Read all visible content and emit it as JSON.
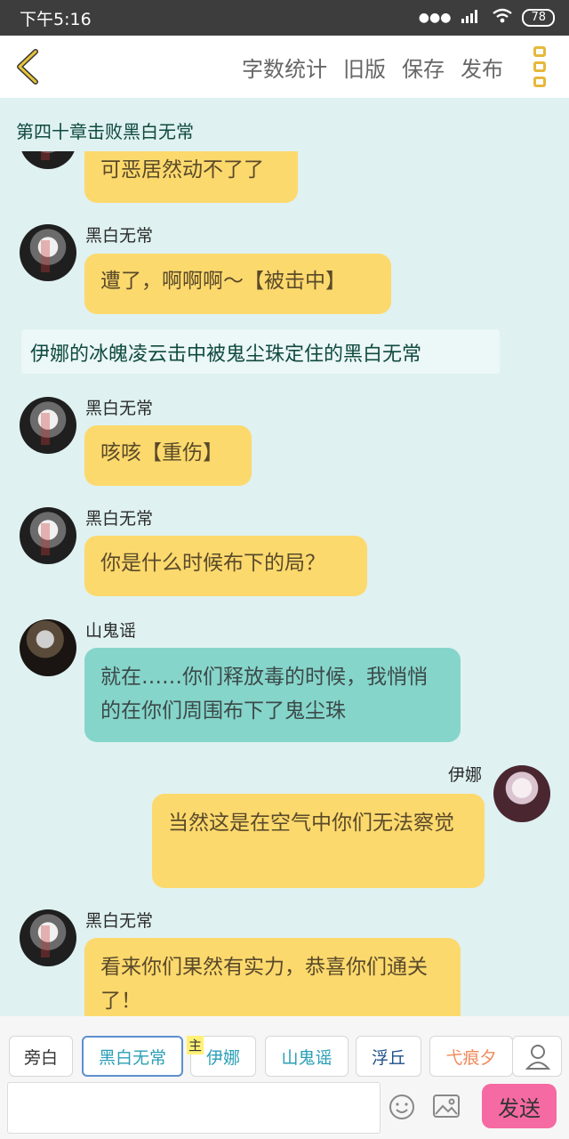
{
  "status_bar": {
    "time": "下午5:16",
    "signal_label": "HD",
    "battery": "78"
  },
  "toolbar": {
    "actions": [
      "字数统计",
      "旧版",
      "保存",
      "发布"
    ]
  },
  "chapter_title": "第四十章击败黑白无常",
  "messages": [
    {
      "speaker": "",
      "text": "可恶居然动不了了",
      "type": "left"
    },
    {
      "speaker": "黑白无常",
      "text": "遭了，啊啊啊～【被击中】",
      "type": "left"
    },
    {
      "speaker": "",
      "text": "伊娜的冰魄凌云击中被鬼尘珠定住的黑白无常",
      "type": "narration"
    },
    {
      "speaker": "黑白无常",
      "text": "咳咳【重伤】",
      "type": "left"
    },
    {
      "speaker": "黑白无常",
      "text": "你是什么时候布下的局？",
      "type": "left"
    },
    {
      "speaker": "山鬼谣",
      "text": "就在……你们释放毒的时候，我悄悄的在你们周围布下了鬼尘珠",
      "type": "left"
    },
    {
      "speaker": "伊娜",
      "text": "当然这是在空气中你们无法察觉",
      "type": "right"
    },
    {
      "speaker": "黑白无常",
      "text": "看来你们果然有实力，恭喜你们通关了！",
      "type": "left"
    }
  ],
  "characters": {
    "items": [
      "旁白",
      "黑白无常",
      "伊娜",
      "山鬼谣",
      "浮丘",
      "弋痕夕"
    ],
    "active": "黑白无常",
    "host_badge": "主",
    "colors": [
      "#333333",
      "#2a9fb6",
      "#2a9fb6",
      "#2a9fb6",
      "#1d4f8a",
      "#f08a5a"
    ]
  },
  "input": {
    "placeholder": "",
    "send_label": "发送"
  }
}
